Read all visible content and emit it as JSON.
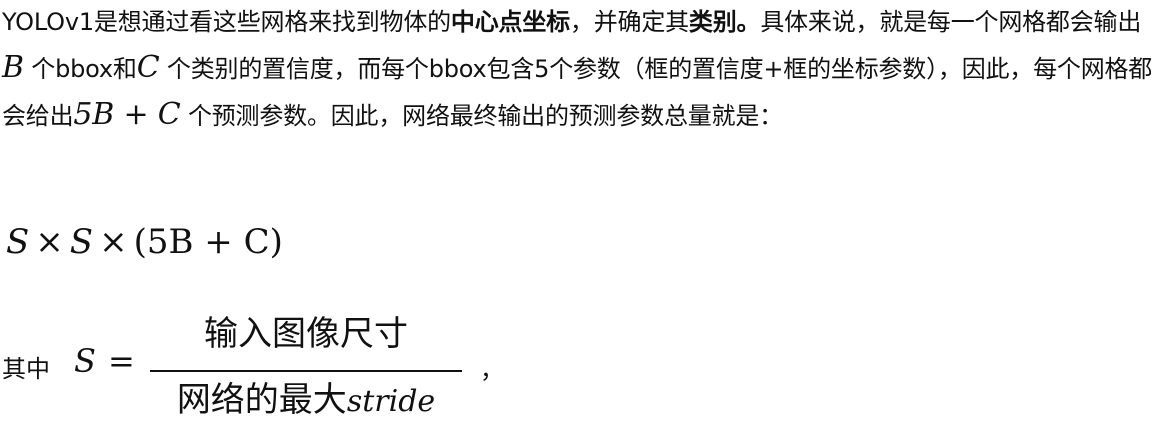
{
  "paragraph": {
    "p1": "YOLOv1是想通过看这些网格来找到物体的",
    "p1_bold": "中心点坐标",
    "p2": "，并确定其",
    "p2_bold": "类别。",
    "p3": "具体来说，就是每一个网格都会输出 ",
    "var_B": "B",
    "p4": " 个bbox和",
    "var_C": "C",
    "p5": " 个类别的置信度，而每个bbox包含5个参数（框的置信度+框的坐标参数），因此，每个网格都会给出",
    "expr_5BC": "5B + C",
    "p6": " 个预测参数。因此，网络最终输出的预测参数总量就是："
  },
  "formula": {
    "S1": "S",
    "times1": "×",
    "S2": "S",
    "times2": "×",
    "paren": "(5B + C)"
  },
  "where": {
    "label": "其中",
    "S": "S",
    "eq": "=",
    "numerator": "输入图像尺寸",
    "denominator_text": "网络的最大",
    "denominator_var": "stride",
    "trailing": "，"
  }
}
